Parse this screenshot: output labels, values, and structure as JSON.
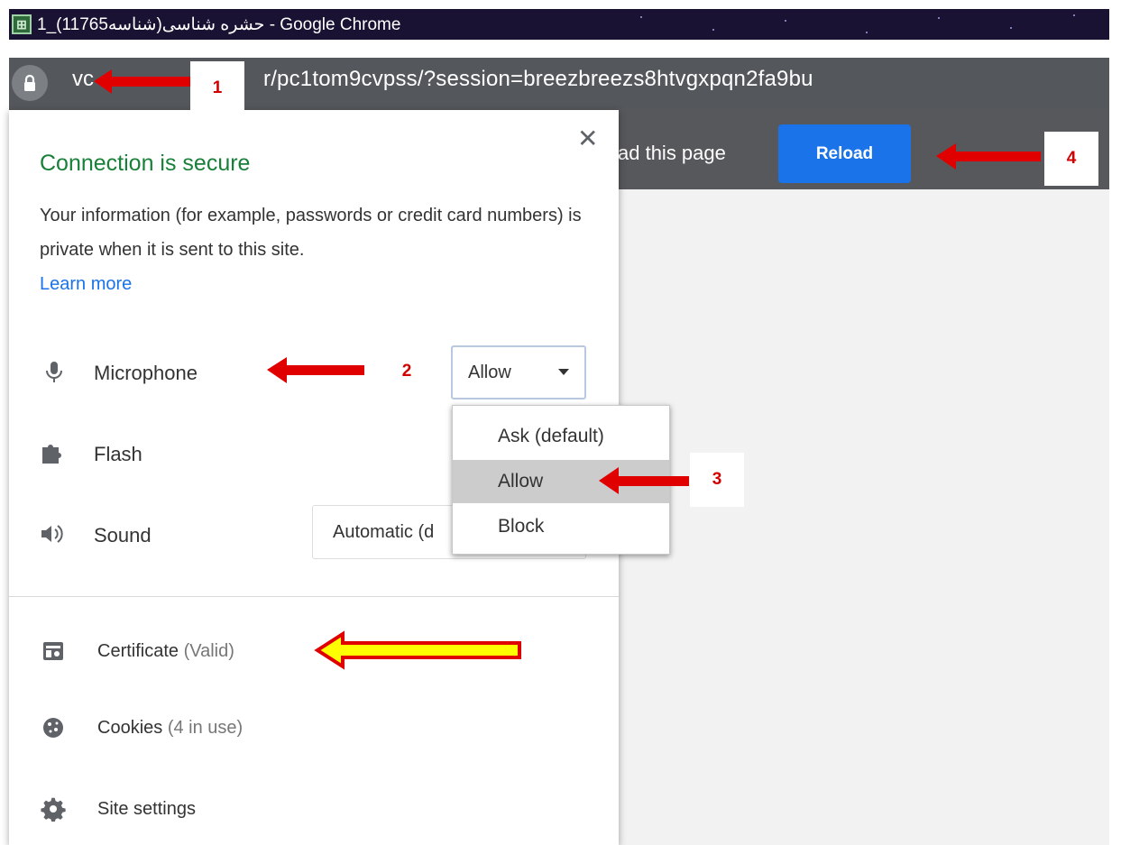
{
  "window": {
    "title": "حشره شناسی(شناسه11765)_1 - Google Chrome"
  },
  "address_bar": {
    "url_partial": "r/pc1tom9cvpss/?session=breezbreezs8htvgxpqn2fa9bu",
    "url_obscured_prefix": "vc"
  },
  "infobar": {
    "message_partial": "ad this page",
    "reload_label": "Reload",
    "reload_color": "#1a73e8"
  },
  "site_info_popup": {
    "title": "Connection is secure",
    "title_color": "#188038",
    "description": "Your information (for example, passwords or credit card numbers) is private when it is sent to this site.",
    "learn_more": "Learn more",
    "permissions": [
      {
        "label": "Microphone",
        "icon": "microphone-icon",
        "value": "Allow"
      },
      {
        "label": "Flash",
        "icon": "puzzle-icon",
        "value": ""
      },
      {
        "label": "Sound",
        "icon": "speaker-icon",
        "value": "Automatic (d"
      }
    ],
    "links": [
      {
        "label": "Certificate",
        "suffix": "(Valid)",
        "icon": "certificate-icon"
      },
      {
        "label": "Cookies",
        "suffix": "(4 in use)",
        "icon": "cookie-icon"
      },
      {
        "label": "Site settings",
        "suffix": "",
        "icon": "gear-icon"
      }
    ]
  },
  "dropdown": {
    "options": [
      "Ask (default)",
      "Allow",
      "Block"
    ],
    "selected": "Allow"
  },
  "annotations": {
    "callouts": [
      "1",
      "2",
      "3",
      "4"
    ],
    "arrow_color": "#e00000",
    "highlight_arrow_fill": "#ffff00"
  }
}
